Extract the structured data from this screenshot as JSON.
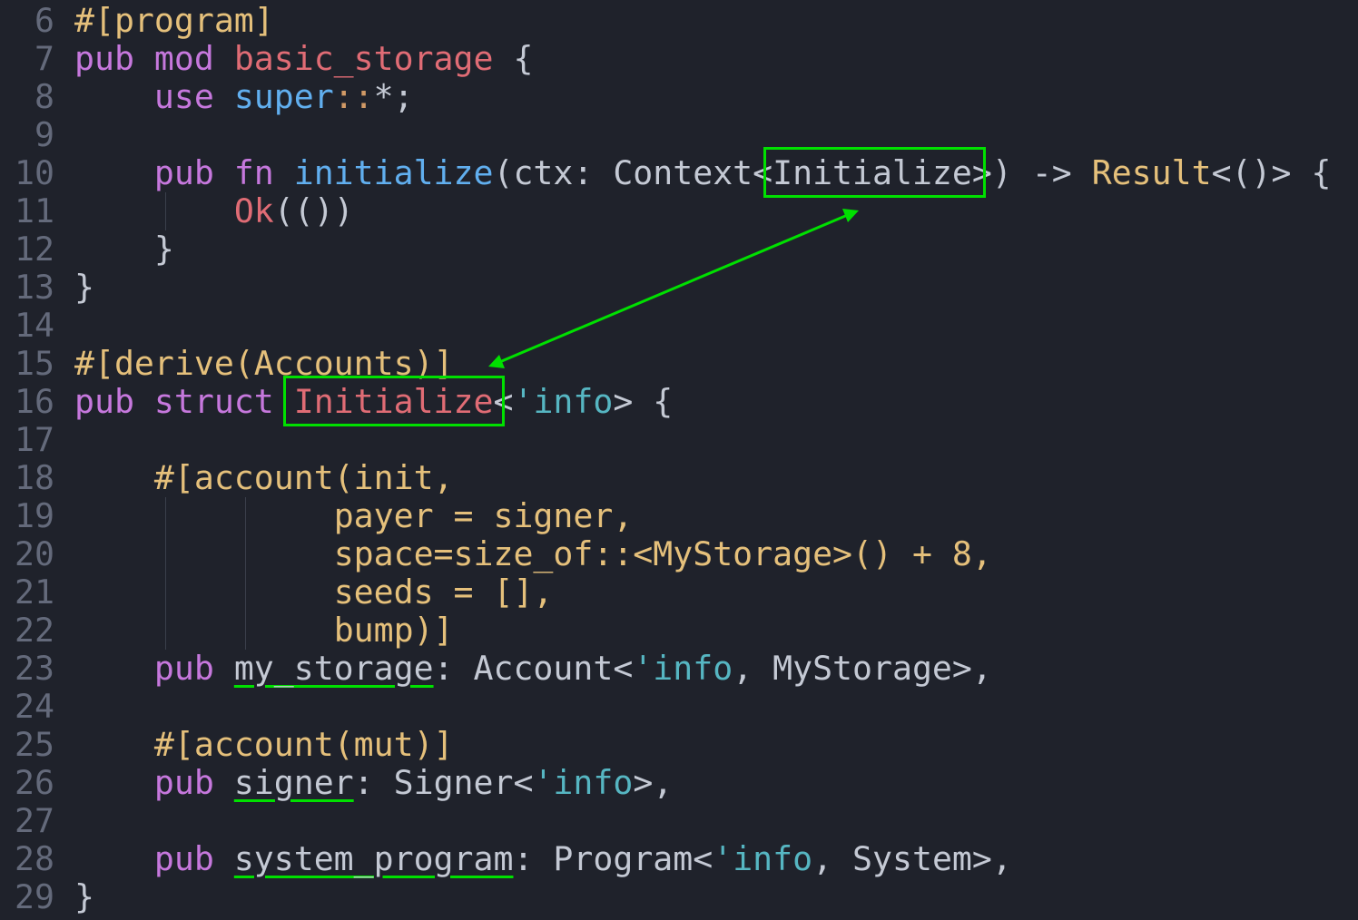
{
  "lines": [
    {
      "n": "6",
      "segs": [
        [
          "ty",
          "#[program]"
        ]
      ]
    },
    {
      "n": "7",
      "segs": [
        [
          "kw",
          "pub mod "
        ],
        [
          "nm",
          "basic_storage"
        ],
        [
          "pl",
          " {"
        ]
      ]
    },
    {
      "n": "8",
      "segs": [
        [
          "pl",
          "    "
        ],
        [
          "kw",
          "use "
        ],
        [
          "fn",
          "super"
        ],
        [
          "op",
          "::"
        ],
        [
          "pl",
          "*;"
        ]
      ]
    },
    {
      "n": "9",
      "segs": []
    },
    {
      "n": "10",
      "segs": [
        [
          "pl",
          "    "
        ],
        [
          "kw",
          "pub fn "
        ],
        [
          "fn",
          "initialize"
        ],
        [
          "pl",
          "(ctx: Context<Initialize>) -> "
        ],
        [
          "ty",
          "Result"
        ],
        [
          "pl",
          "<()> {"
        ]
      ]
    },
    {
      "n": "11",
      "segs": [
        [
          "pl",
          "        "
        ],
        [
          "nm",
          "Ok"
        ],
        [
          "pl",
          "(())"
        ]
      ]
    },
    {
      "n": "12",
      "segs": [
        [
          "pl",
          "    }"
        ]
      ]
    },
    {
      "n": "13",
      "segs": [
        [
          "pl",
          "}"
        ]
      ]
    },
    {
      "n": "14",
      "segs": []
    },
    {
      "n": "15",
      "segs": [
        [
          "ty",
          "#[derive(Accounts)]"
        ]
      ]
    },
    {
      "n": "16",
      "segs": [
        [
          "kw",
          "pub struct "
        ],
        [
          "nm",
          "Initialize"
        ],
        [
          "pl",
          "<"
        ],
        [
          "lt",
          "'info"
        ],
        [
          "pl",
          "> {"
        ]
      ]
    },
    {
      "n": "17",
      "segs": []
    },
    {
      "n": "18",
      "segs": [
        [
          "pl",
          "    "
        ],
        [
          "ty",
          "#[account(init,"
        ]
      ]
    },
    {
      "n": "19",
      "segs": [
        [
          "pl",
          "             "
        ],
        [
          "ty",
          "payer = signer,"
        ]
      ]
    },
    {
      "n": "20",
      "segs": [
        [
          "pl",
          "             "
        ],
        [
          "ty",
          "space=size_of::<MyStorage>() + 8,"
        ]
      ]
    },
    {
      "n": "21",
      "segs": [
        [
          "pl",
          "             "
        ],
        [
          "ty",
          "seeds = [],"
        ]
      ]
    },
    {
      "n": "22",
      "segs": [
        [
          "pl",
          "             "
        ],
        [
          "ty",
          "bump)]"
        ]
      ]
    },
    {
      "n": "23",
      "segs": [
        [
          "pl",
          "    "
        ],
        [
          "kw",
          "pub "
        ],
        [
          "ul",
          "my_storage"
        ],
        [
          "pl",
          ": Account<"
        ],
        [
          "lt",
          "'info"
        ],
        [
          "pl",
          ", MyStorage>,"
        ]
      ]
    },
    {
      "n": "24",
      "segs": []
    },
    {
      "n": "25",
      "segs": [
        [
          "pl",
          "    "
        ],
        [
          "ty",
          "#[account(mut)]"
        ]
      ]
    },
    {
      "n": "26",
      "segs": [
        [
          "pl",
          "    "
        ],
        [
          "kw",
          "pub "
        ],
        [
          "ul",
          "signer"
        ],
        [
          "pl",
          ": Signer<"
        ],
        [
          "lt",
          "'info"
        ],
        [
          "pl",
          ">,"
        ]
      ]
    },
    {
      "n": "27",
      "segs": []
    },
    {
      "n": "28",
      "segs": [
        [
          "pl",
          "    "
        ],
        [
          "kw",
          "pub "
        ],
        [
          "ul",
          "system_program"
        ],
        [
          "pl",
          ": Program<"
        ],
        [
          "lt",
          "'info"
        ],
        [
          "pl",
          ", System>,"
        ]
      ]
    },
    {
      "n": "29",
      "segs": [
        [
          "pl",
          "}"
        ]
      ]
    }
  ],
  "colors": {
    "background": "#1f222b",
    "keyword": "#c678dd",
    "function": "#61afef",
    "attribute": "#e5c07b",
    "name": "#e06c75",
    "lifetime": "#56b6c2",
    "plain": "#c4c9d4",
    "annotation": "#00e000"
  }
}
